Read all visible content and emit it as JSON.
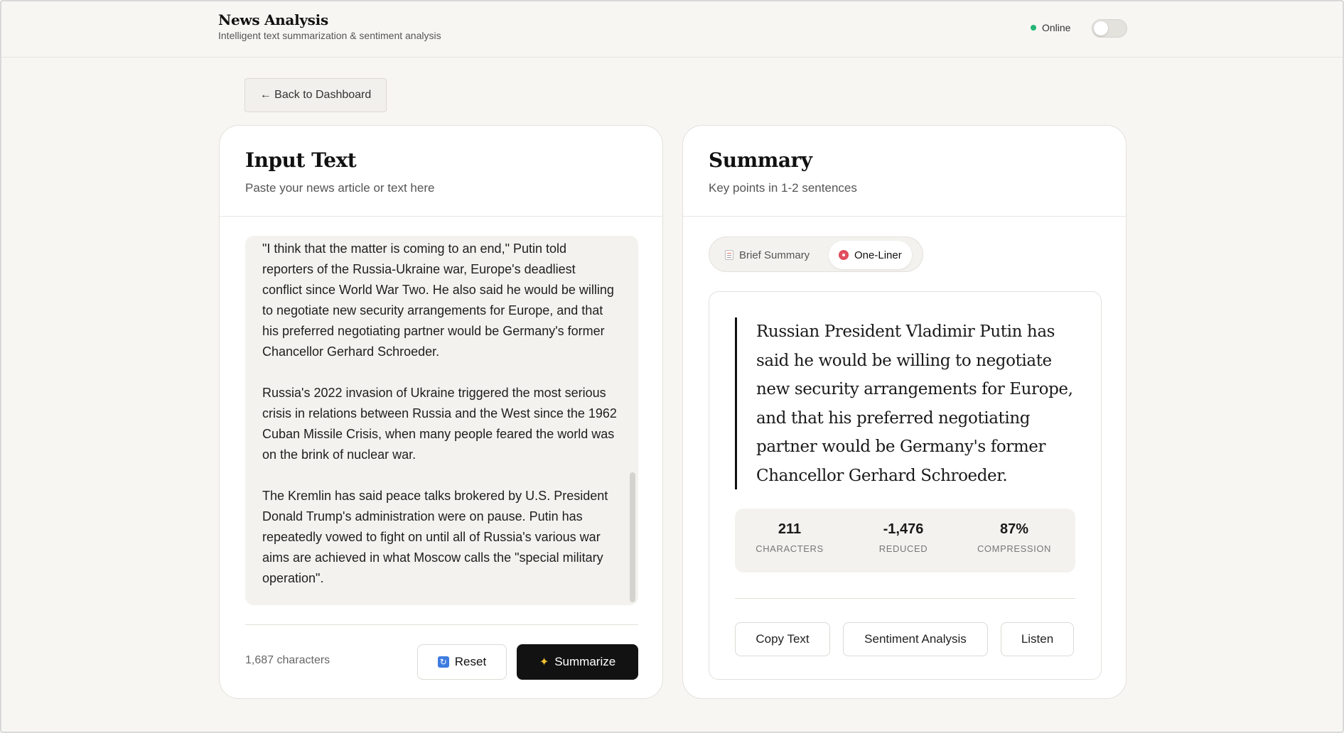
{
  "header": {
    "title": "News Analysis",
    "subtitle": "Intelligent text summarization & sentiment analysis",
    "status": "Online"
  },
  "nav": {
    "back_label": "← Back to Dashboard"
  },
  "input_card": {
    "title": "Input Text",
    "subtitle": "Paste your news article or text here",
    "text": "\"I think that the matter is coming to an end,\" Putin told reporters of the Russia-Ukraine war, Europe's deadliest conflict since World War Two. He also said he would be willing to negotiate new security arrangements for Europe, and that his preferred negotiating partner would be Germany's former Chancellor Gerhard Schroeder.\n\nRussia's 2022 invasion of Ukraine triggered the most serious crisis in relations between Russia and the West since the 1962 Cuban Missile Crisis, when many people feared the world was on the brink of nuclear war.\n\nThe Kremlin has said peace talks brokered by U.S. President Donald Trump's administration were on pause. Putin has repeatedly vowed to fight on until all of Russia's various war aims are achieved in what Moscow calls the \"special military operation\".",
    "char_count": "1,687 characters",
    "reset_label": "Reset",
    "summarize_label": "Summarize"
  },
  "summary_card": {
    "title": "Summary",
    "subtitle": "Key points in 1-2 sentences",
    "tabs": [
      {
        "label": "Brief Summary",
        "icon": "memo-icon",
        "active": false
      },
      {
        "label": "One-Liner",
        "icon": "target-icon",
        "active": true
      }
    ],
    "summary_text": "Russian President Vladimir Putin has said he would be willing to negotiate new security arrangements for Europe, and that his preferred negotiating partner would be Germany's former Chancellor Gerhard Schroeder.",
    "stats": [
      {
        "value": "211",
        "label": "CHARACTERS"
      },
      {
        "value": "-1,476",
        "label": "REDUCED"
      },
      {
        "value": "87%",
        "label": "COMPRESSION"
      }
    ],
    "actions": {
      "copy": "Copy Text",
      "sentiment": "Sentiment Analysis",
      "listen": "Listen"
    }
  },
  "colors": {
    "background": "#f7f6f3",
    "online": "#22b573",
    "primary_button": "#121212"
  }
}
